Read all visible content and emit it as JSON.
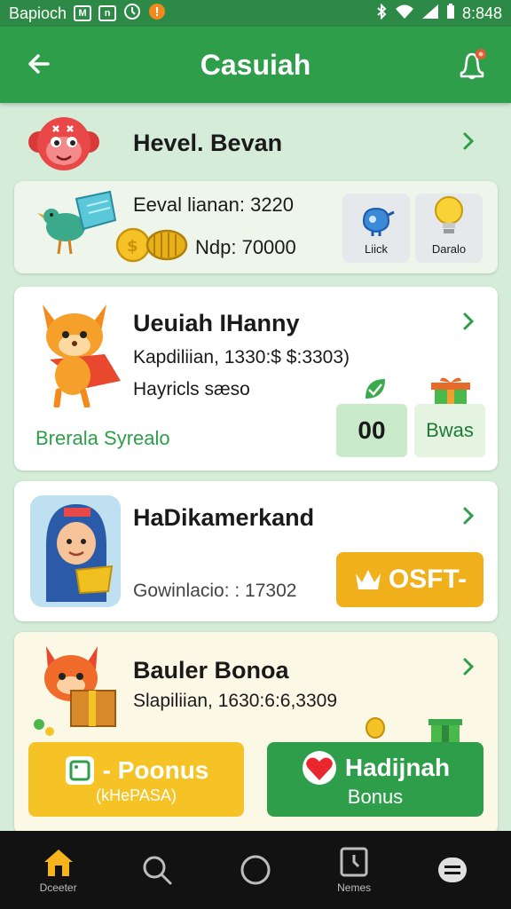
{
  "status_bar": {
    "carrier": "Bapioch",
    "time": "8:848"
  },
  "header": {
    "title": "Casuiah"
  },
  "profile": {
    "name": "Hevel. Bevan"
  },
  "balance_card": {
    "line1": "Eeval lianan: 3220",
    "line2": "Ndp: 70000",
    "tiles": [
      {
        "label": "Liick"
      },
      {
        "label": "Daralo"
      }
    ]
  },
  "task_card": {
    "title": "Ueuiah IHanny",
    "line1": "Kapdiliian, 1330:$ $:3303)",
    "line2": "Hayricls sæso",
    "link": "Brerala Syrealo",
    "tiles": [
      {
        "label": "00"
      },
      {
        "label": "Bwas"
      }
    ]
  },
  "offer_card": {
    "title": "HaDikamerkand",
    "line1": "Gowinlacio: : 17302",
    "button_label": "OSFT-"
  },
  "bonus_card": {
    "title": "Bauler Bonoa",
    "line1": "Slapiliian, 1630:6:6,3309",
    "btn1_label": "- Poonus",
    "btn1_sub": "(kHePASA)",
    "btn2_label": "Hadijnah",
    "btn2_sub": "Bonus"
  },
  "nav": [
    {
      "label": "Dceeter",
      "icon": "home-icon"
    },
    {
      "label": "",
      "icon": "search-icon"
    },
    {
      "label": "",
      "icon": "circle-icon"
    },
    {
      "label": "Nemes",
      "icon": "clock-document-icon"
    },
    {
      "label": "",
      "icon": "menu-icon"
    }
  ],
  "colors": {
    "primary": "#2e9e4a",
    "accent": "#f0b01c",
    "yellow": "#f5c326",
    "background": "#d4ecd8",
    "navbar": "#121212"
  }
}
